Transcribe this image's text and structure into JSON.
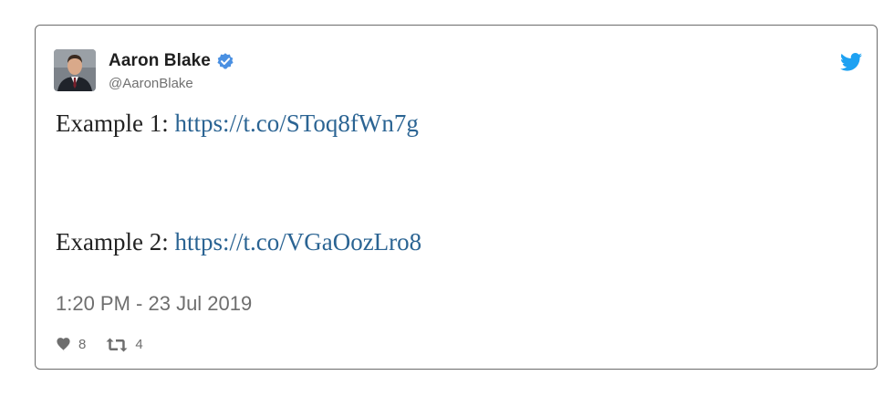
{
  "tweet": {
    "author_name": "Aaron Blake",
    "handle": "@AaronBlake",
    "verified": true,
    "lines": [
      {
        "prefix": "Example 1: ",
        "link": "https://t.co/SToq8fWn7g"
      },
      {
        "prefix": "Example 2: ",
        "link": "https://t.co/VGaOozLro8"
      }
    ],
    "timestamp": "1:20 PM - 23 Jul 2019",
    "likes": "8",
    "retweets": "4"
  },
  "icons": {
    "brand": "twitter-bird-icon",
    "verified": "verified-badge-icon",
    "like": "heart-icon",
    "retweet": "retweet-icon"
  },
  "colors": {
    "link": "#2b6493",
    "brand_blue": "#1da1f2",
    "muted_text": "#6e6e6e",
    "border": "#6b6b6b"
  }
}
